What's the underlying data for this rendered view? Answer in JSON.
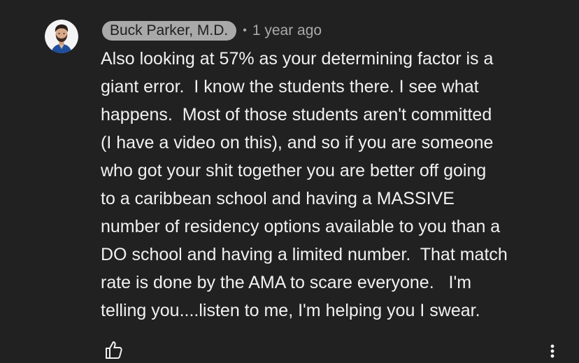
{
  "comment": {
    "author": "Buck Parker, M.D.",
    "separator": "•",
    "timestamp": "1 year ago",
    "body_lines": [
      "Also looking at 57% as your determining factor is a",
      "giant error.  I know the students there. I see what",
      "happens.  Most of those students aren't committed",
      "(I have a video on this), and so if you are someone",
      "who got your shit together you are better off going",
      "to a caribbean school and having a MASSIVE",
      "number of residency options available to you than a",
      "DO school and having a limited number.  That match",
      "rate is done by the AMA to scare everyone.   I'm",
      "telling you....listen to me, I'm helping you I swear."
    ]
  },
  "icons": {
    "avatar": "avatar",
    "like": "thumbs-up-icon",
    "menu": "more-vert-icon"
  },
  "colors": {
    "background": "#212121",
    "text": "#f1f1f1",
    "author_badge_bg": "#a9a9a9",
    "meta_text": "#aaaaaa"
  }
}
